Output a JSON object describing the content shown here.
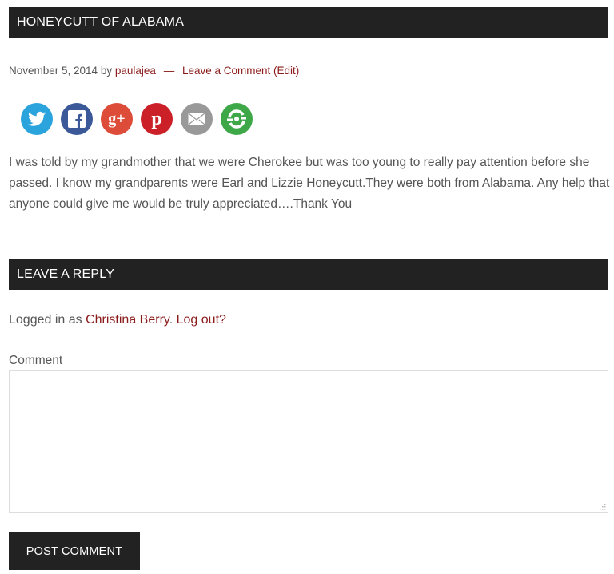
{
  "post": {
    "title": "HONEYCUTT OF ALABAMA",
    "date": "November 5, 2014",
    "by": "by",
    "author": "paulajea",
    "separator": "—",
    "comment_link": "Leave a Comment",
    "edit_link": "(Edit)",
    "body": "I was told by my grandmother that we were Cherokee but was too young to really pay attention before she passed. I know my grandparents were Earl and Lizzie Honeycutt.They were both from Alabama. Any help that anyone could give me would be truly appreciated….Thank You"
  },
  "share": [
    {
      "name": "twitter-icon",
      "color": "#2ba3dd"
    },
    {
      "name": "facebook-icon",
      "color": "#3b5998"
    },
    {
      "name": "google-plus-icon",
      "color": "#dd4b39"
    },
    {
      "name": "pinterest-icon",
      "color": "#cb2027"
    },
    {
      "name": "email-icon",
      "color": "#999999"
    },
    {
      "name": "share-icon",
      "color": "#3ea849"
    }
  ],
  "reply": {
    "heading": "LEAVE A REPLY",
    "logged_prefix": "Logged in as",
    "user": "Christina Berry",
    "logout": "Log out?",
    "comment_label": "Comment",
    "comment_value": "",
    "submit": "POST COMMENT"
  },
  "colors": {
    "accent": "#8b1a1a",
    "bar": "#222222"
  }
}
